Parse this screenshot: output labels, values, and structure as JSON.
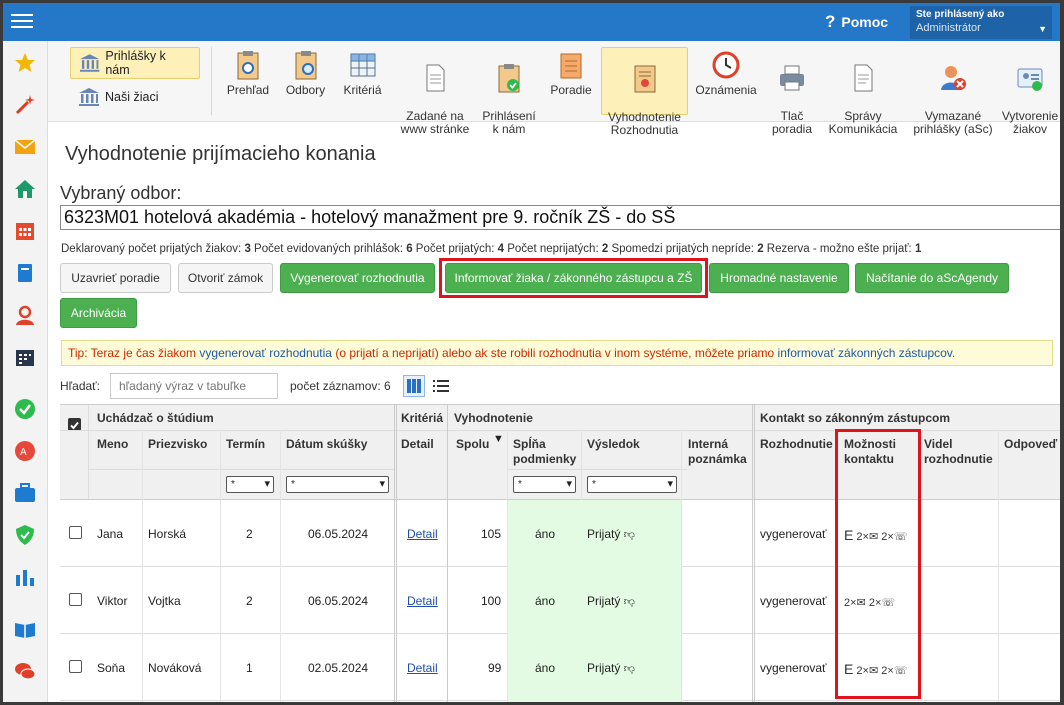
{
  "topbar": {
    "help": "Pomoc",
    "user_line1": "Ste prihlásený ako",
    "user_line2": "Administrátor"
  },
  "toolbar": {
    "left": [
      {
        "label": "Prihlášky k nám",
        "icon": "bank-icon"
      },
      {
        "label": "Naši žiaci",
        "icon": "bank-icon"
      }
    ],
    "items": [
      {
        "label": "Prehľad",
        "icon": "clipboard-eye-icon"
      },
      {
        "label": "Odbory",
        "icon": "clipboard-search-icon"
      },
      {
        "label": "Kritériá",
        "icon": "grid-icon"
      },
      {
        "label": "Zadané na\nwww stránke",
        "icon": "document-icon"
      },
      {
        "label": "Prihlásení\nk nám",
        "icon": "clipboard-check-icon"
      },
      {
        "label": "Poradie",
        "icon": "notepad-icon"
      },
      {
        "label": "Vyhodnotenie\nRozhodnutia",
        "icon": "certificate-icon"
      },
      {
        "label": "Oznámenia",
        "icon": "clock-icon"
      },
      {
        "label": "Tlač\nporadia",
        "icon": "printer-icon"
      },
      {
        "label": "Správy\nKomunikácia",
        "icon": "letter-icon"
      },
      {
        "label": "Vymazané\nprihlášky (aSc)",
        "icon": "user-delete-icon"
      },
      {
        "label": "Vytvorenie\nžiakov",
        "icon": "user-card-icon"
      }
    ]
  },
  "page": {
    "title": "Vyhodnotenie prijímacieho konania",
    "odbor_label": "Vybraný odbor:",
    "odbor_value": "6323M01 hotelová akadémia - hotelový manažment pre 9. ročník ZŠ - do SŠ",
    "stats": {
      "t1": "Deklarovaný počet prijatých žiakov: ",
      "v1": "3",
      "t2": " Počet evidovaných prihlášok: ",
      "v2": "6",
      "t3": " Počet prijatých: ",
      "v3": "4",
      "t4": " Počet neprijatých: ",
      "v4": "2",
      "t5": " Spomedzi prijatých nepríde: ",
      "v5": "2",
      "t6": " Rezerva - možno ešte prijať: ",
      "v6": "1"
    }
  },
  "buttons": {
    "uzavriet": "Uzavrieť poradie",
    "otvorit": "Otvoriť zámok",
    "vygenerovat": "Vygenerovať rozhodnutia",
    "informovat": "Informovať žiaka / zákonného zástupcu a ZŠ",
    "hromadne": "Hromadné nastavenie",
    "nacitanie": "Načítanie do aScAgendy",
    "archivacia": "Archivácia"
  },
  "tip": {
    "t1": "Tip: Teraz je čas žiakom ",
    "link1": "vygenerovať rozhodnutia",
    "t2": " (o prijatí a neprijatí) alebo ak ste robili rozhodnutia v inom systéme, môžete priamo ",
    "link2": "informovať zákonných zástupcov",
    "t3": "."
  },
  "search": {
    "label": "Hľadať:",
    "placeholder": "hľadaný výraz v tabuľke",
    "count": "počet záznamov: 6"
  },
  "table": {
    "groups": {
      "uchadzac": "Uchádzač o štúdium",
      "kriteria": "Kritériá",
      "vyhodnotenie": "Vyhodnotenie",
      "kontakt": "Kontakt so zákonným zástupcom"
    },
    "columns": {
      "meno": "Meno",
      "priezvisko": "Priezvisko",
      "termin": "Termín",
      "datum": "Dátum skúšky",
      "detail": "Detail",
      "spolu": "Spolu",
      "splna": "Spĺňa\npodmienky",
      "vysledok": "Výsledok",
      "interna": "Interná\npoznámka",
      "rozhodnutie": "Rozhodnutie",
      "moznosti": "Možnosti\nkontaktu",
      "videl": "Videl\nrozhodnutie",
      "odpoved": "Odpoveď"
    },
    "filter_value": "*",
    "sort_icon": "sort-down-icon",
    "rows": [
      {
        "meno": "Jana",
        "priezvisko": "Horská",
        "termin": "2",
        "datum": "06.05.2024",
        "detail": "Detail",
        "spolu": "105",
        "splna": "áno",
        "vysledok": "Prijatý",
        "rozhodnutie": "vygenerovať",
        "email": "E",
        "mail_count": "2×",
        "phone_count": "2×"
      },
      {
        "meno": "Viktor",
        "priezvisko": "Vojtka",
        "termin": "2",
        "datum": "06.05.2024",
        "detail": "Detail",
        "spolu": "100",
        "splna": "áno",
        "vysledok": "Prijatý",
        "rozhodnutie": "vygenerovať",
        "email": "",
        "mail_count": "2×",
        "phone_count": "2×"
      },
      {
        "meno": "Soňa",
        "priezvisko": "Nováková",
        "termin": "1",
        "datum": "02.05.2024",
        "detail": "Detail",
        "spolu": "99",
        "splna": "áno",
        "vysledok": "Prijatý",
        "rozhodnutie": "vygenerovať",
        "email": "E",
        "mail_count": "2×",
        "phone_count": "2×"
      }
    ]
  },
  "colors": {
    "topbar": "#2577c8",
    "green_button": "#4caf50",
    "highlight_red": "#e0121b"
  }
}
